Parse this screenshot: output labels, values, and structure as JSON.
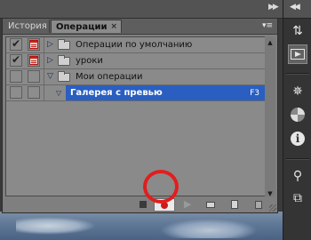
{
  "panel": {
    "tabs": [
      {
        "label": "История"
      },
      {
        "label": "Операции",
        "close": "×"
      }
    ],
    "menu_icon": "panel-menu-icon"
  },
  "actions": [
    {
      "label": "Операции по умолчанию",
      "checked": true,
      "dialog": true,
      "expanded": false
    },
    {
      "label": "уроки",
      "checked": true,
      "dialog": true,
      "expanded": false
    },
    {
      "label": "Мои операции",
      "checked": false,
      "dialog": false,
      "expanded": true
    },
    {
      "label": "Галерея с превью",
      "shortcut": "F3",
      "selected": true
    }
  ],
  "toolbar": {
    "buttons": [
      "stop-icon",
      "record-icon",
      "play-icon",
      "new-set-icon",
      "new-action-icon",
      "trash-icon"
    ],
    "record_color": "#cc1a1a",
    "highlight_color": "#e21d1d"
  },
  "dock": {
    "icons": [
      "history-icon",
      "actions-icon",
      "navigator-icon",
      "color-icon",
      "info-icon",
      "tool-presets-icon",
      "layer-comps-icon"
    ],
    "info_glyph": "i"
  },
  "colors": {
    "selection": "#2a5fc1",
    "panel_bg": "#8a8a8a"
  }
}
